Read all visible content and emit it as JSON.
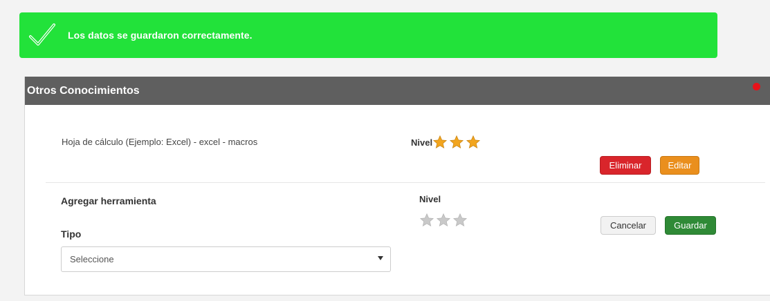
{
  "alert": {
    "message": "Los datos se guardaron correctamente.",
    "icon": "check-icon",
    "color": "#22e23a"
  },
  "panel": {
    "title": "Otros Conocimientos",
    "header_color": "#5f5f5f",
    "badge_icon": "alert-dot-icon"
  },
  "existing_item": {
    "name": "Hoja de cálculo (Ejemplo: Excel) - excel - macros",
    "nivel_label": "Nivel",
    "rating": 3,
    "rating_max": 3,
    "delete_label": "Eliminar",
    "edit_label": "Editar"
  },
  "new_item": {
    "title": "Agregar herramienta",
    "tipo_label": "Tipo",
    "tipo_selected": "Seleccione",
    "nivel_label": "Nivel",
    "rating": 0,
    "rating_max": 3,
    "cancel_label": "Cancelar",
    "save_label": "Guardar"
  },
  "colors": {
    "delete": "#d9252b",
    "edit": "#ea8f1d",
    "save": "#2f8a36",
    "star_filled": "#f2a51e",
    "star_empty": "#c9c9c9"
  }
}
